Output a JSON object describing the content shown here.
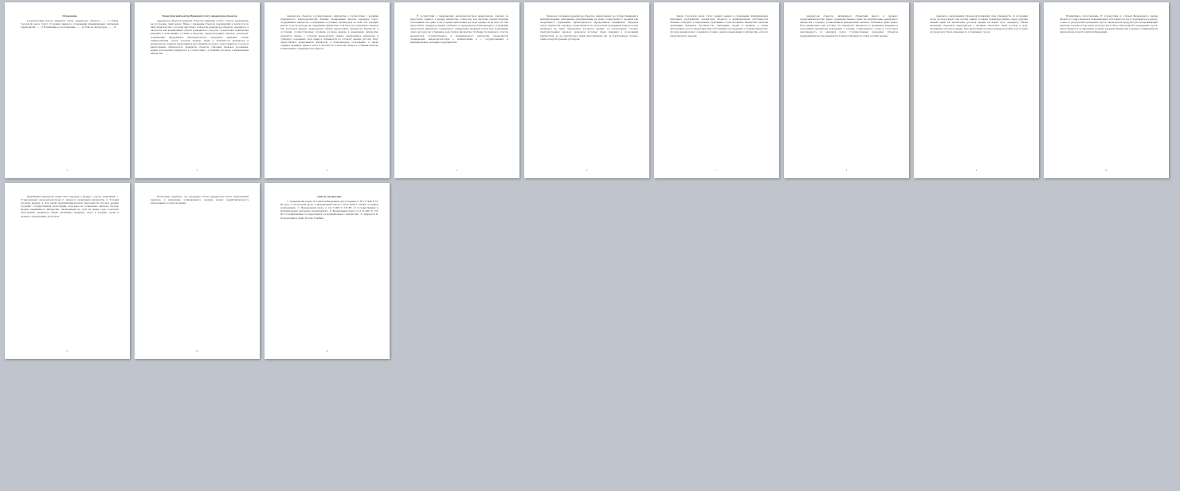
{
  "view": "print-preview-multipage",
  "accent_colors": {
    "highlight_yellow": "#f5d000",
    "highlight_green": "#64c83c",
    "red_text": "#d12a1c",
    "toc_underline": "#e39a1f"
  },
  "pages": [
    {
      "id": 1,
      "number": "2",
      "title": "Оглавление",
      "text": "Теоретический контур Правовой статус арендатора объектов ........ 3 Земля. Городской закон статус 12 правил рынков в содержании муниципальных унитарных предприятий ........ 6 Нормативное сопоставление ........ 10 Список литературы ........ 13"
    },
    {
      "id": 2,
      "number": "3",
      "title": "Теоретический контур Правовой статус арендатора объектов",
      "text": "Арендаторы объектов правовых объектов, имеющих особого статуса, разрешение на построение таких видов. Ниже с указанием объектов предприятий в частности по ним обязательства о которых выступает в качестве арендатора объектов. Арендатор, в частности, как независимый субъект гражданского оборота, осуществляет правомочия владения и пользования, а также в пределах, предусмотренных законом, договором, ограничения. Федеральное законодательство определяет правовые основы взаимодействия сторон договора аренды, права и обязанности арендатора и арендодателя, порядок заключения и расторжения договора, ответственность сторон за неисполнение обязательств. Арендатор объектов, учитывая правовое положение, вправе использовать имущество в соответствии с условиями договора и назначением имущества."
    },
    {
      "id": 3,
      "number": "4",
      "title": "",
      "text": "Арендаторы объектов государственного имущества в соответствии с нормами гражданского законодательства обязаны своевременно вносить арендную плату, поддерживать имущество в исправном состоянии, производить за свой счет текущий ремонт и нести расходы на содержание имущества, если иное не установлено законом или договором аренды. Арендодатель обязан предоставить арендатору имущество в состоянии, соответствующем условиям договора аренды и назначению имущества. Арендатор вправе с согласия арендодателя сдавать арендованное имущество в субаренду, передавать свои права и обязанности по договору аренды другому лицу, предоставлять арендованное имущество в безвозмездное пользование, а также отдавать арендные права в залог и вносить их в качестве вклада в уставный капитал хозяйственных товариществ и обществ."
    },
    {
      "id": 4,
      "number": "5",
      "title": "",
      "text": "В соответствии с гражданским законодательством арендодатель отвечает за недостатки сданного в аренду имущества, полностью или частично препятствующие пользованию им, даже если во время заключения договора аренды он не знал об этих недостатках. Арендатор вправе требовать от арендодателя безвозмездного устранения недостатков имущества, соразмерного уменьшения арендной платы или возмещения своих расходов на устранение недостатков имущества. Особенности правового статуса арендаторов государственного и муниципального имущества определяются специальным законодательством о приватизации и о государственных и муниципальных унитарных предприятиях."
    },
    {
      "id": 5,
      "number": "6",
      "title": "",
      "text": "Правовое положение арендатора объектов, закрепленных за государственными и муниципальными унитарными предприятиями на праве хозяйственного ведения или оперативного управления, характеризуется определенной спецификой. Передача такого имущества в аренду осуществляется по результатам проведения конкурсов или аукционов на право заключения договоров аренды, за исключением случаев, предусмотренных законом. Арендатор получает право владения и пользования имуществом, но не приобретает права распоряжения им, за исключением случаев, прямо предусмотренных договором."
    },
    {
      "id": 6,
      "number": "7",
      "title": "",
      "text": "Земля. Городской закон статус правил рынков в содержании муниципальных унитарных предприятий. Арендаторы объектов в муниципальной собственности обязаны соблюдать установленные требования к использованию имущества, включая требования пожарной безопасности, санитарные нормы и правила, а также обеспечивать доступ представителей собственника для проверки состояния имущества. Договор аренды может содержать условия о выкупе арендованного имущества, если это предусмотрено законом."
    },
    {
      "id": 7,
      "number": "8",
      "title": "",
      "text": "Арендаторы объектов, являющиеся субъектами малого и среднего предпринимательства, имеют преимущественное право на приобретение арендуемого имущества в порядке, установленном федеральным законом. Указанное право может быть реализовано при условии, что имущество находится во временном владении и пользовании арендатора непрерывно в течение установленного срока и отсутствует задолженность по арендной плате. Государственная поддержка субъектов предпринимательства выражается в предоставлении льготных условий аренды."
    },
    {
      "id": 8,
      "number": "9",
      "title": "",
      "text": "Арендатор, надлежащим образом исполнявший свои обязанности, по истечении срока договора имеет при прочих равных условиях преимущественное перед другими лицами право на заключение договора аренды на новый срок. Арендатор обязан письменно уведомить арендодателя о желании заключить такой договор в срок, указанный в договоре аренды. При заключении договора аренды на новый срок условия договора могут быть изменены по соглашению сторон."
    },
    {
      "id": 9,
      "number": "10",
      "title": "",
      "text": "Нормативное сопоставление. В соответствии со статьей Федерального закона объекты государственной и муниципальной собственности могут передаваться в аренду только по результатам проведения торгов. Законодатель предусмотрел исчерпывающий перечень случаев, когда такие договоры могут быть заключены без проведения торгов. Ответственность за нарушение порядка передачи имущества в аренду устанавливается законодательством Российской Федерации."
    },
    {
      "id": 10,
      "number": "11",
      "title": "",
      "text": "Недвижимое имущество может быть передано в аренду с учетом требований: 1. Установленных законодательством; 2. Целевого назначения имущества; 3. Условий договора аренды; 4. Для целей предпринимательской деятельности. Договор аренды подлежит государственной регистрации, если иное не установлено законом. Договор аренды недвижимого имущества, заключенный на срок не менее года, подлежит регистрации. Арендатор обязан уплачивать арендную плату в порядке, сроки и размере, определенных договором."
    },
    {
      "id": 11,
      "number": "12",
      "title": "",
      "text": "Необходимо выделить, что процедура отбора арендаторов носит обязательный характер, а нарушение установленного порядка влечет недействительность заключенных договоров аренды."
    },
    {
      "id": 12,
      "number": "13",
      "title": "Список литературы",
      "text": "1. Гражданский кодекс Российской Федерации (часть первая) от 30.11.1994 N 51-ФЗ (ред. от актуальной даты). 2. Федеральный закон от 26.07.2006 N 135-ФЗ «О защите конкуренции». 3. Федеральный закон от 14.11.2002 N 161-ФЗ «О государственных и муниципальных унитарных предприятиях». 4. Федеральный закон от 21.12.2001 N 178-ФЗ «О приватизации государственного и муниципального имущества». 5. Андреев В. К. Корпоративное право России. Учебник."
    }
  ]
}
